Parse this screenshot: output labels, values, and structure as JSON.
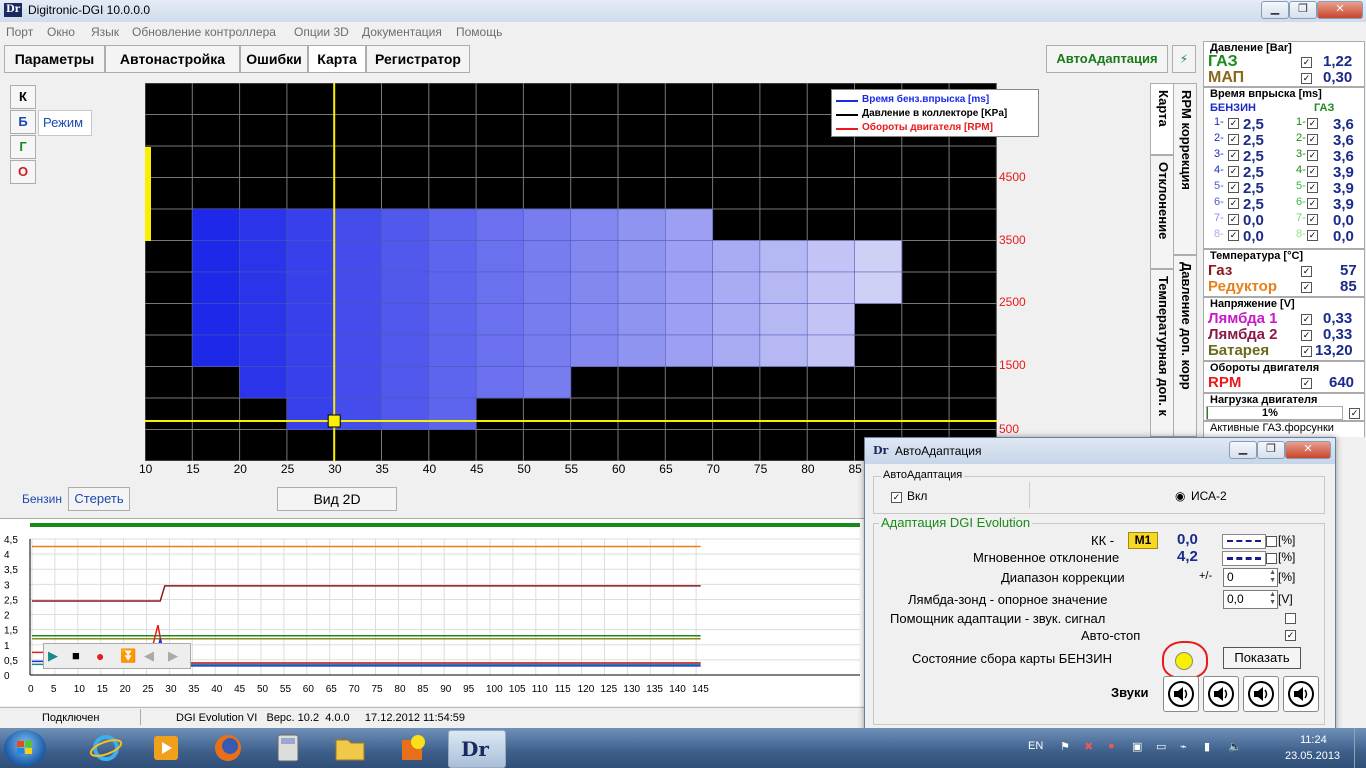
{
  "window": {
    "title": "Digitronic-DGI  10.0.0.0",
    "logo": "Dr"
  },
  "menu": [
    "Порт",
    "Окно",
    "Язык",
    "Обновление контроллера",
    "Опции 3D",
    "Документация",
    "Помощь"
  ],
  "tabs": [
    "Параметры",
    "Автонастройка",
    "Ошибки",
    "Карта",
    "Регистратор"
  ],
  "autoadapt_button": "АвтоАдаптация",
  "mode_buttons": [
    "К",
    "Б",
    "Г",
    "О"
  ],
  "mode_label": "Режим",
  "map": {
    "legend": [
      "Время бенз.впрыска [ms]",
      "Давление в коллекторе [KPa]",
      "Обороты двигателя [RPM]"
    ],
    "x_ticks": [
      "10",
      "15",
      "20",
      "25",
      "30",
      "35",
      "40",
      "45",
      "50",
      "55",
      "60",
      "65",
      "70",
      "75",
      "80",
      "85"
    ],
    "y_ticks": [
      "4500",
      "3500",
      "2500",
      "1500",
      "500"
    ],
    "crosshair_x": 30,
    "crosshair_y": 500
  },
  "vertical_tabs": [
    "Карта",
    "RPM коррекция",
    "Отклонение",
    "Давление доп. корр",
    "Температурная доп. к"
  ],
  "bottom_controls": {
    "fuel_label": "Бензин",
    "clear_button": "Стереть",
    "view_button": "Вид 2D"
  },
  "log_chart": {
    "y_ticks": [
      "4,5",
      "4",
      "3,5",
      "3",
      "2,5",
      "2",
      "1,5",
      "1",
      "0,5",
      "0"
    ],
    "x_ticks": [
      "0",
      "5",
      "10",
      "15",
      "20",
      "25",
      "30",
      "35",
      "40",
      "45",
      "50",
      "55",
      "60",
      "65",
      "70",
      "75",
      "80",
      "85",
      "90",
      "95",
      "100",
      "105",
      "110",
      "115",
      "120",
      "125",
      "130",
      "135",
      "140",
      "145"
    ]
  },
  "right_panel": {
    "pressure": {
      "header": "Давление [Bar]",
      "gas_label": "ГАЗ",
      "gas_value": "1,22",
      "map_label": "МАП",
      "map_value": "0,30"
    },
    "injection": {
      "header": "Время впрыска [ms]",
      "petrol_header": "БЕНЗИН",
      "gas_header": "ГАЗ",
      "rows": [
        {
          "n": "1-",
          "p": "2,5",
          "g": "3,6"
        },
        {
          "n": "2-",
          "p": "2,5",
          "g": "3,6"
        },
        {
          "n": "3-",
          "p": "2,5",
          "g": "3,6"
        },
        {
          "n": "4-",
          "p": "2,5",
          "g": "3,9"
        },
        {
          "n": "5-",
          "p": "2,5",
          "g": "3,9"
        },
        {
          "n": "6-",
          "p": "2,5",
          "g": "3,9"
        },
        {
          "n": "7-",
          "p": "0,0",
          "g": "0,0"
        },
        {
          "n": "8-",
          "p": "0,0",
          "g": "0,0"
        }
      ]
    },
    "temperature": {
      "header": "Температура  [°C]",
      "gas_label": "Газ",
      "gas_value": "57",
      "reducer_label": "Редуктор",
      "reducer_value": "85"
    },
    "voltage": {
      "header": "Напряжение [V]",
      "lambda1_label": "Лямбда 1",
      "lambda1_value": "0,33",
      "lambda2_label": "Лямбда 2",
      "lambda2_value": "0,33",
      "battery_label": "Батарея",
      "battery_value": "13,20"
    },
    "rpm": {
      "header": "Обороты двигателя",
      "label": "RPM",
      "value": "640"
    },
    "load": {
      "header": "Нагрузка двигателя",
      "value": "1%"
    },
    "active_injectors": {
      "header": "Активные ГАЗ.форсунки"
    }
  },
  "status_bar": {
    "connection": "Подключен",
    "version": "DGI Evolution VI   Верс. 10.2  4.0.0     17.12.2012 11:54:59"
  },
  "dialog": {
    "title": "АвтоАдаптация",
    "group1": "АвтоАдаптация",
    "enable_label": "Вкл",
    "mode_label": "ИСА-2",
    "group2": "Адаптация DGI Evolution",
    "kk_label": "КК -",
    "kk_badge": "M1",
    "kk_value": "0,0",
    "instant_label": "Мгновенное отклонение",
    "instant_value": "4,2",
    "unit_percent": "[%]",
    "range_label": "Диапазон коррекции",
    "range_prefix": "+/-",
    "range_value": "0",
    "lambda_label": "Лямбда-зонд - опорное значение",
    "lambda_value": "0,0",
    "unit_volt": "[V]",
    "helper_label": "Помощник адаптации - звук. сигнал",
    "autostop_label": "Авто-стоп",
    "state_label": "Состояние сбора карты БЕНЗИН",
    "show_button": "Показать",
    "sounds_label": "Звуки"
  },
  "taskbar": {
    "lang": "EN",
    "time": "11:24",
    "date": "23.05.2013",
    "app_label": "Dr"
  }
}
